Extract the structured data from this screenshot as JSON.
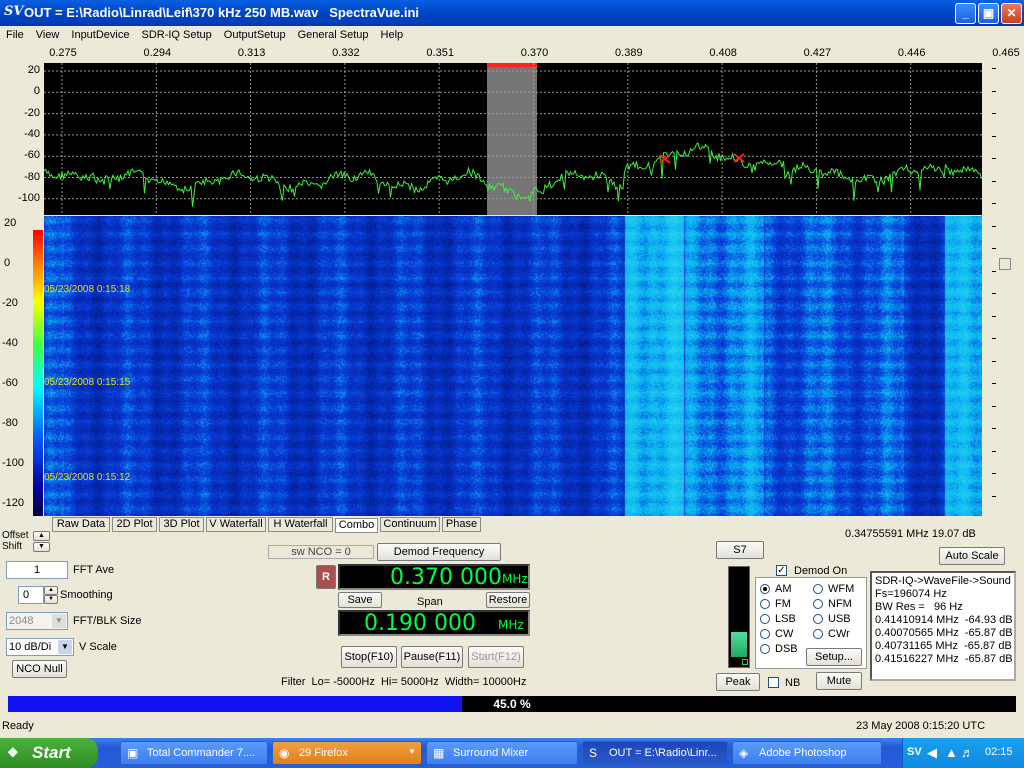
{
  "window": {
    "icon": "SV",
    "title": "OUT = E:\\Radio\\Linrad\\Leif\\370 kHz 250 MB.wav   SpectraVue.ini",
    "min_icon": "minimize-icon",
    "max_icon": "maximize-icon",
    "close_icon": "close-icon"
  },
  "menu": [
    "File",
    "View",
    "InputDevice",
    "SDR-IQ Setup",
    "OutputSetup",
    "General Setup",
    "Help"
  ],
  "freq_ticks": [
    "0.275",
    "0.294",
    "0.313",
    "0.332",
    "0.351",
    "0.370",
    "0.389",
    "0.408",
    "0.427",
    "0.446",
    "0.465"
  ],
  "spectrum_db_ticks": [
    "20",
    "0",
    "-20",
    "-40",
    "-60",
    "-80",
    "-100"
  ],
  "waterfall_db_ticks": [
    "20",
    "0",
    "-20",
    "-40",
    "-60",
    "-80",
    "-100",
    "-120"
  ],
  "waterfall_timestamps": [
    "05/23/2008 0:15:18",
    "05/23/2008 0:15:15",
    "05/23/2008 0:15:12"
  ],
  "tabs": [
    "Raw Data",
    "2D Plot",
    "3D Plot",
    "V Waterfall",
    "H Waterfall",
    "Combo",
    "Continuum",
    "Phase"
  ],
  "active_tab": "Combo",
  "offset_label": "Offset",
  "shift_label": "Shift",
  "cursor_readout": "0.34755591 MHz  19.07 dB",
  "fft_ave": {
    "value": "1",
    "label": "FFT Ave"
  },
  "smoothing": {
    "value": "0",
    "label": "Smoothing"
  },
  "fft_blk": {
    "value": "2048",
    "label": "FFT/BLK Size"
  },
  "vscale": {
    "value": "10 dB/Di",
    "label": "V Scale"
  },
  "nco_null": "NCO Null",
  "sw_nco": "sw NCO = 0",
  "demod_freq_button": "Demod Frequency",
  "r_button": "R",
  "center_freq": {
    "value": "0.370 000",
    "unit": "MHz"
  },
  "save_button": "Save",
  "span_label": "Span",
  "restore_button": "Restore",
  "span_freq": {
    "value": "0.190 000",
    "unit": "MHz"
  },
  "stop_button": "Stop(F10)",
  "pause_button": "Pause(F11)",
  "start_button": "Start(F12)",
  "filter_text": "Filter  Lo= -5000Hz  Hi= 5000Hz  Width= 10000Hz",
  "smeter_button": "S7",
  "smeter_level": 0.28,
  "peak_button": "Peak",
  "nb_label": "NB",
  "mute_button": "Mute",
  "demod_on_label": "Demod On",
  "modes": [
    [
      "AM",
      "WFM"
    ],
    [
      "FM",
      "NFM"
    ],
    [
      "LSB",
      "USB"
    ],
    [
      "CW",
      "CWr"
    ],
    [
      "DSB"
    ]
  ],
  "selected_mode": "AM",
  "setup_button": "Setup...",
  "auto_scale_button": "Auto Scale",
  "info_lines": [
    "SDR-IQ->WaveFile->Sound",
    "Fs=196074 Hz",
    "BW Res =   96 Hz",
    "0.41410914 MHz  -64.93 dB",
    "0.40070565 MHz  -65.87 dB",
    "0.40731165 MHz  -65.87 dB",
    "0.41516227 MHz  -65.87 dB"
  ],
  "progress": {
    "fraction": 0.45,
    "label": "45.0 %"
  },
  "status_left": "Ready",
  "status_right": "23 May 2008  0:15:20 UTC",
  "taskbar": {
    "start": "Start",
    "tasks": [
      "Total Commander 7....",
      "29 Firefox",
      "Surround Mixer",
      "OUT = E:\\Radio\\Linr...",
      "Adobe Photoshop"
    ],
    "tray_text": "SV",
    "clock": "02:15"
  },
  "colors": {
    "spectrum_trace": "#3cf03c",
    "peak_marker": "#ff2020",
    "passband": "#8a8a8a",
    "lcd_text": "#00ff3c",
    "progress": "#1010f0"
  }
}
